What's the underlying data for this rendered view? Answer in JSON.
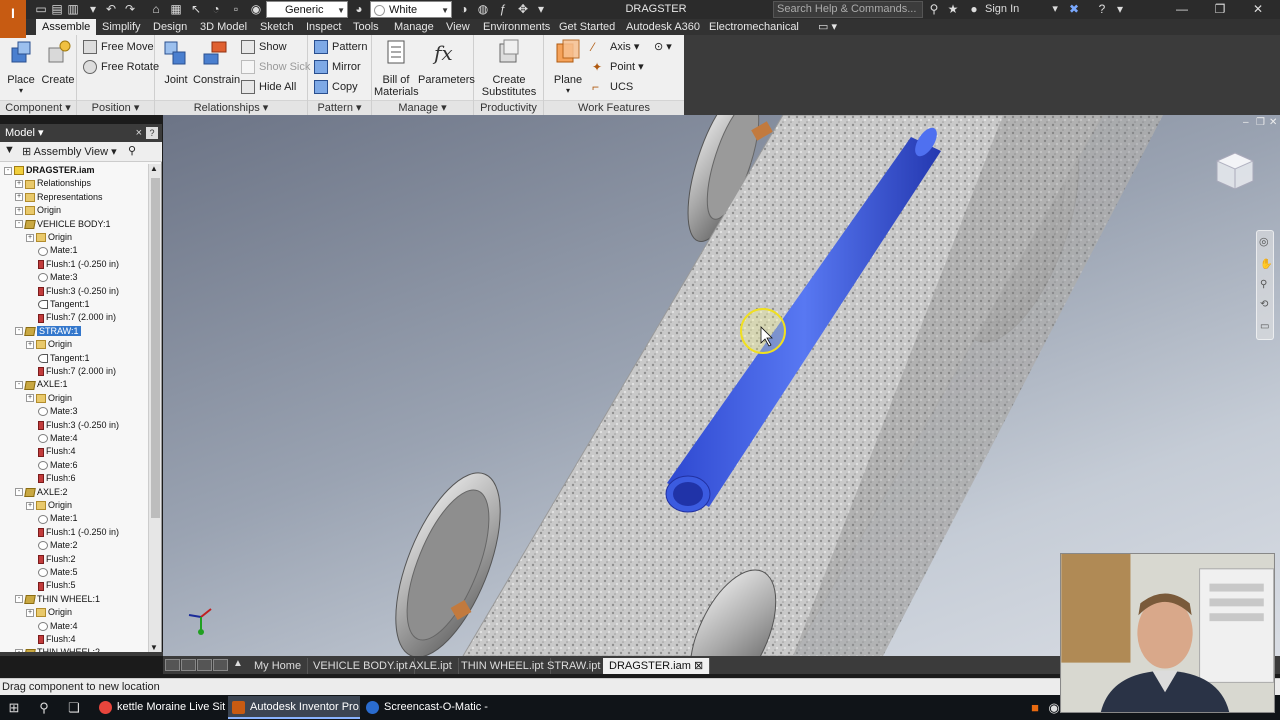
{
  "app": {
    "logo_text": "I",
    "document_title": "DRAGSTER",
    "search_placeholder": "Search Help & Commands...",
    "sign_in": "Sign In",
    "material_select": "Generic",
    "appearance_select": "White"
  },
  "ribbon_tabs": [
    "Assemble",
    "Simplify",
    "Design",
    "3D Model",
    "Sketch",
    "Inspect",
    "Tools",
    "Manage",
    "View",
    "Environments",
    "Get Started",
    "Autodesk A360",
    "Electromechanical"
  ],
  "ribbon": {
    "component": {
      "label": "Component",
      "place": "Place",
      "create": "Create"
    },
    "position": {
      "label": "Position",
      "free_move": "Free Move",
      "free_rotate": "Free Rotate"
    },
    "relationships": {
      "label": "Relationships",
      "joint": "Joint",
      "constrain": "Constrain",
      "show": "Show",
      "show_sick": "Show Sick",
      "hide_all": "Hide All"
    },
    "pattern": {
      "label": "Pattern",
      "pattern": "Pattern",
      "mirror": "Mirror",
      "copy": "Copy"
    },
    "manage": {
      "label": "Manage",
      "bom_line1": "Bill of",
      "bom_line2": "Materials",
      "parameters": "Parameters"
    },
    "productivity": {
      "label": "Productivity",
      "create_sub_line1": "Create",
      "create_sub_line2": "Substitutes"
    },
    "work_features": {
      "label": "Work Features",
      "plane": "Plane",
      "axis": "Axis",
      "point": "Point",
      "ucs": "UCS"
    }
  },
  "browser": {
    "title": "Model",
    "view": "Assembly View",
    "tree": [
      {
        "label": "DRAGSTER.iam",
        "icon": "asm-icon",
        "level": 0,
        "bold": true
      },
      {
        "label": "Relationships",
        "icon": "folder-icon",
        "level": 1
      },
      {
        "label": "Representations",
        "icon": "folder-icon",
        "level": 1
      },
      {
        "label": "Origin",
        "icon": "folder-icon",
        "level": 1
      },
      {
        "label": "VEHICLE BODY:1",
        "icon": "part-icon",
        "level": 1
      },
      {
        "label": "Origin",
        "icon": "folder-icon",
        "level": 2
      },
      {
        "label": "Mate:1",
        "icon": "mate-icon",
        "level": 2
      },
      {
        "label": "Flush:1 (-0.250 in)",
        "icon": "flush-icon",
        "level": 2
      },
      {
        "label": "Mate:3",
        "icon": "mate-icon",
        "level": 2
      },
      {
        "label": "Flush:3 (-0.250 in)",
        "icon": "flush-icon",
        "level": 2
      },
      {
        "label": "Tangent:1",
        "icon": "tangent-icon",
        "level": 2
      },
      {
        "label": "Flush:7 (2.000 in)",
        "icon": "flush-icon",
        "level": 2
      },
      {
        "label": "STRAW:1",
        "icon": "part-icon",
        "level": 1,
        "selected": true
      },
      {
        "label": "Origin",
        "icon": "folder-icon",
        "level": 2
      },
      {
        "label": "Tangent:1",
        "icon": "tangent-icon",
        "level": 2
      },
      {
        "label": "Flush:7 (2.000 in)",
        "icon": "flush-icon",
        "level": 2
      },
      {
        "label": "AXLE:1",
        "icon": "part-icon",
        "level": 1
      },
      {
        "label": "Origin",
        "icon": "folder-icon",
        "level": 2
      },
      {
        "label": "Mate:3",
        "icon": "mate-icon",
        "level": 2
      },
      {
        "label": "Flush:3 (-0.250 in)",
        "icon": "flush-icon",
        "level": 2
      },
      {
        "label": "Mate:4",
        "icon": "mate-icon",
        "level": 2
      },
      {
        "label": "Flush:4",
        "icon": "flush-icon",
        "level": 2
      },
      {
        "label": "Mate:6",
        "icon": "mate-icon",
        "level": 2
      },
      {
        "label": "Flush:6",
        "icon": "flush-icon",
        "level": 2
      },
      {
        "label": "AXLE:2",
        "icon": "part-icon",
        "level": 1
      },
      {
        "label": "Origin",
        "icon": "folder-icon",
        "level": 2
      },
      {
        "label": "Mate:1",
        "icon": "mate-icon",
        "level": 2
      },
      {
        "label": "Flush:1 (-0.250 in)",
        "icon": "flush-icon",
        "level": 2
      },
      {
        "label": "Mate:2",
        "icon": "mate-icon",
        "level": 2
      },
      {
        "label": "Flush:2",
        "icon": "flush-icon",
        "level": 2
      },
      {
        "label": "Mate:5",
        "icon": "mate-icon",
        "level": 2
      },
      {
        "label": "Flush:5",
        "icon": "flush-icon",
        "level": 2
      },
      {
        "label": "THIN WHEEL:1",
        "icon": "part-icon",
        "level": 1
      },
      {
        "label": "Origin",
        "icon": "folder-icon",
        "level": 2
      },
      {
        "label": "Mate:4",
        "icon": "mate-icon",
        "level": 2
      },
      {
        "label": "Flush:4",
        "icon": "flush-icon",
        "level": 2
      },
      {
        "label": "THIN WHEEL:2",
        "icon": "part-icon",
        "level": 1
      }
    ]
  },
  "document_tabs": [
    "My Home",
    "VEHICLE BODY.ipt",
    "AXLE.ipt",
    "THIN WHEEL.ipt",
    "STRAW.ipt",
    "DRAGSTER.iam"
  ],
  "active_document_tab": "DRAGSTER.iam",
  "status_text": "Drag component to new location",
  "taskbar": {
    "apps": [
      "kettle Moraine Live Sit...",
      "Autodesk Inventor Pro...",
      "Screencast-O-Matic - ..."
    ]
  },
  "colors": {
    "straw_blue": "#3f5fe6",
    "accent_orange": "#c75b12",
    "selection_blue": "#3377cc"
  }
}
